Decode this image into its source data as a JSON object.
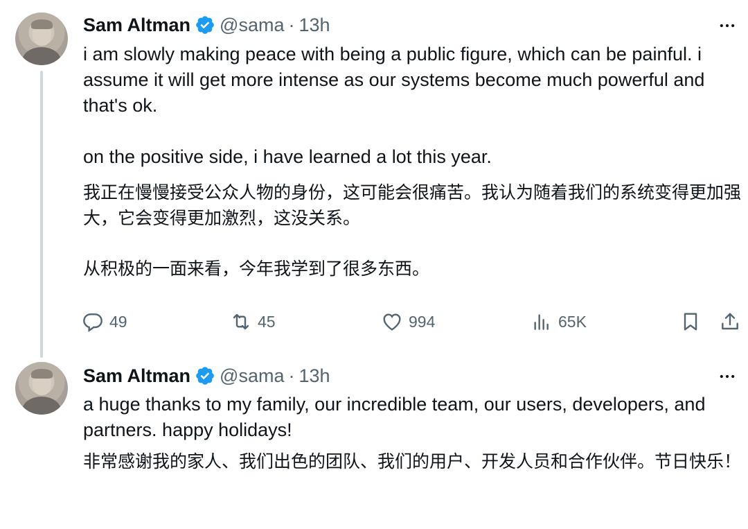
{
  "tweets": [
    {
      "author": {
        "name": "Sam Altman",
        "handle": "@sama",
        "verified": true
      },
      "time": "13h",
      "separator": "·",
      "paragraphs_en": [
        "i am slowly making peace with being a public figure, which can be painful. i assume it will get more intense as our systems become much powerful and that's ok.",
        "on the positive side, i have learned a lot this year."
      ],
      "paragraphs_zh": [
        "我正在慢慢接受公众人物的身份，这可能会很痛苦。我认为随着我们的系统变得更加强大，它会变得更加激烈，这没关系。",
        "从积极的一面来看，今年我学到了很多东西。"
      ],
      "actions": {
        "replies": "49",
        "retweets": "45",
        "likes": "994",
        "views": "65K"
      }
    },
    {
      "author": {
        "name": "Sam Altman",
        "handle": "@sama",
        "verified": true
      },
      "time": "13h",
      "separator": "·",
      "paragraphs_en": [
        "a huge thanks to my family, our incredible team, our users, developers, and partners. happy holidays!"
      ],
      "paragraphs_zh": [
        "非常感谢我的家人、我们出色的团队、我们的用户、开发人员和合作伙伴。节日快乐！"
      ]
    }
  ],
  "icons": {
    "more": "more-horizontal-icon",
    "verified": "verified-badge-icon",
    "reply": "reply-icon",
    "retweet": "retweet-icon",
    "like": "like-icon",
    "views": "views-icon",
    "bookmark": "bookmark-icon",
    "share": "share-icon"
  },
  "colors": {
    "verified": "#1d9bf0",
    "text": "#0f1419",
    "secondary": "#536471",
    "thread_line": "#cfd9de"
  }
}
